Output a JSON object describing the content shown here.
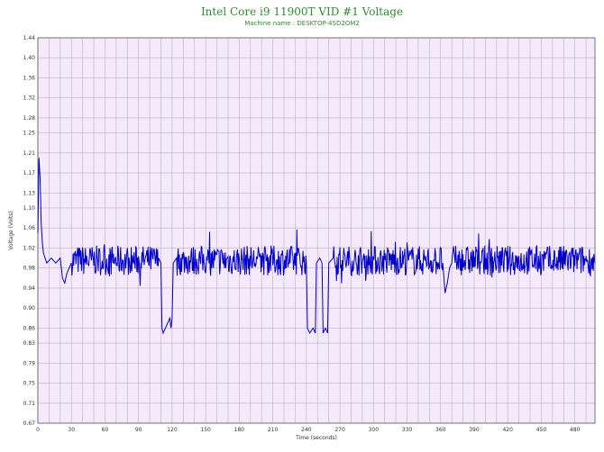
{
  "chart_data": {
    "type": "line",
    "title": "Intel Core i9 11900T VID #1 Voltage",
    "subtitle": "Machine name : DESKTOP-4SD2OM2",
    "xlabel": "Time (seconds)",
    "ylabel": "Voltage (Volts)",
    "xlim": [
      0,
      498
    ],
    "ylim": [
      0.67,
      1.44
    ],
    "x_ticks": [
      0,
      30,
      60,
      90,
      120,
      150,
      180,
      210,
      240,
      270,
      300,
      330,
      360,
      390,
      420,
      450,
      480
    ],
    "y_ticks": [
      "0.67",
      "0.71",
      "0.75",
      "0.79",
      "0.83",
      "0.86",
      "0.90",
      "0.94",
      "0.98",
      "1.02",
      "1.06",
      "1.10",
      "1.13",
      "1.17",
      "1.21",
      "1.25",
      "1.28",
      "1.32",
      "1.36",
      "1.40",
      "1.44"
    ],
    "grid": true,
    "series": [
      {
        "color": "#0000cc",
        "baseline": 0.995,
        "points": [
          [
            0,
            1.05
          ],
          [
            1,
            1.2
          ],
          [
            2,
            1.16
          ],
          [
            3,
            1.07
          ],
          [
            4,
            1.03
          ],
          [
            5,
            1.01
          ],
          [
            8,
            0.99
          ],
          [
            12,
            1.0
          ],
          [
            16,
            0.99
          ],
          [
            20,
            1.0
          ],
          [
            22,
            0.96
          ],
          [
            24,
            0.95
          ],
          [
            26,
            0.97
          ],
          [
            30,
            0.99
          ],
          [
            108,
            1.0
          ],
          [
            110,
            0.99
          ],
          [
            111,
            0.86
          ],
          [
            112,
            0.85
          ],
          [
            114,
            0.86
          ],
          [
            116,
            0.87
          ],
          [
            118,
            0.88
          ],
          [
            119,
            0.86
          ],
          [
            120,
            0.88
          ],
          [
            121,
            0.99
          ],
          [
            124,
            1.0
          ],
          [
            240,
            0.99
          ],
          [
            241,
            0.86
          ],
          [
            243,
            0.85
          ],
          [
            246,
            0.86
          ],
          [
            248,
            0.85
          ],
          [
            249,
            0.99
          ],
          [
            252,
            1.0
          ],
          [
            254,
            0.99
          ],
          [
            255,
            0.85
          ],
          [
            257,
            0.86
          ],
          [
            259,
            0.85
          ],
          [
            260,
            0.99
          ],
          [
            264,
            1.0
          ],
          [
            362,
            0.99
          ],
          [
            364,
            0.93
          ],
          [
            366,
            0.95
          ],
          [
            368,
            0.98
          ],
          [
            370,
            0.99
          ],
          [
            498,
            0.99
          ]
        ]
      }
    ]
  }
}
